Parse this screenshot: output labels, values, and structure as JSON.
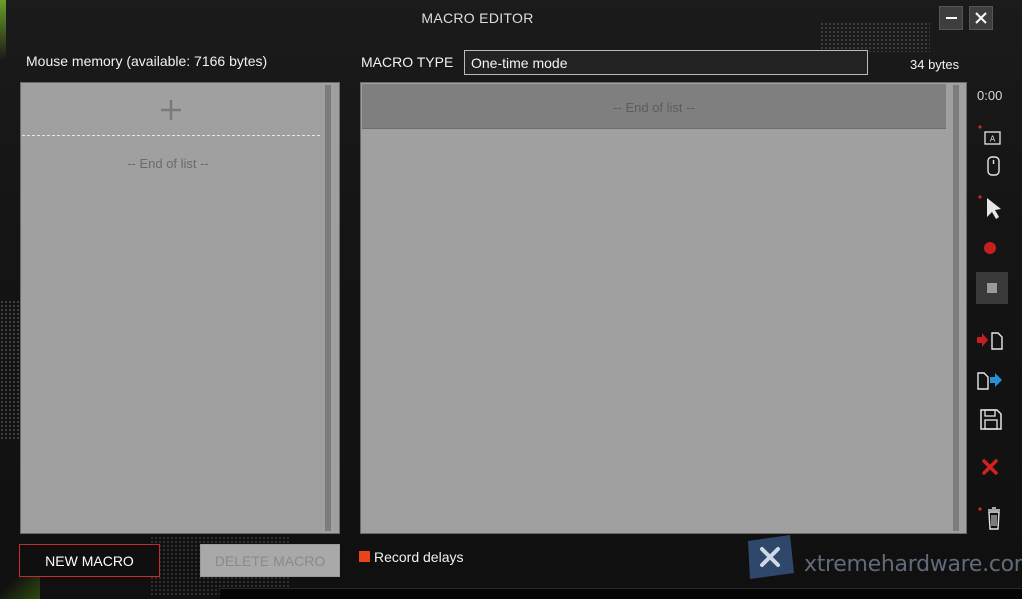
{
  "window": {
    "title": "MACRO EDITOR",
    "minimize_icon": "minimize-icon",
    "close_icon": "close-icon"
  },
  "left": {
    "memory_label": "Mouse memory (available: 7166 bytes)",
    "add_icon": "plus-icon",
    "end_of_list": "-- End of list --"
  },
  "macro": {
    "type_label": "MACRO TYPE",
    "type_value": "One-time mode",
    "bytes": "34 bytes",
    "end_of_list": "-- End of list --"
  },
  "toolbar": {
    "timer": "0:00",
    "tools": [
      "keyboard-key-icon",
      "mouse-icon",
      "cursor-icon",
      "record-icon",
      "stop-icon",
      "import-file-icon",
      "export-file-icon",
      "save-icon",
      "delete-icon",
      "trash-icon"
    ]
  },
  "footer": {
    "new_macro": "NEW MACRO",
    "delete_macro": "DELETE MACRO",
    "record_delays": "Record delays"
  },
  "watermark": {
    "text": "xtremehardware.com"
  },
  "colors": {
    "accent_red": "#c62a2a",
    "record_orange": "#e8441a",
    "panel_gray": "#a0a0a0",
    "export_blue": "#2a8fd0"
  }
}
